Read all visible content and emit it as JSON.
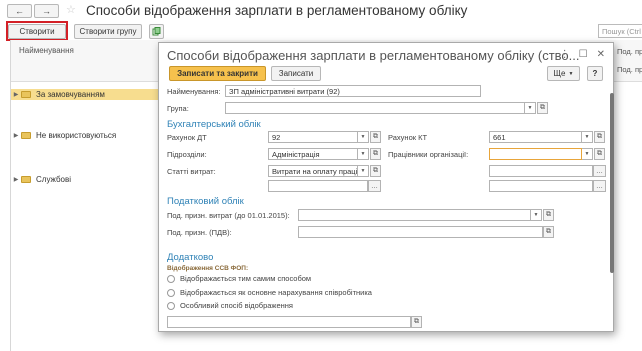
{
  "window": {
    "back": "←",
    "forward": "→",
    "title": "Способи відображення зарплати в регламентованому обліку"
  },
  "toolbar": {
    "create_label": "Створити",
    "create_group_label": "Створити групу",
    "search_placeholder": "Пошук (Ctrl"
  },
  "grid": {
    "col_name": "Найменування",
    "col_right_1": "Под. приз",
    "col_right_2": "Под. приз",
    "rows": [
      {
        "label": "За замовчуванням"
      },
      {
        "label": "Не використовуються"
      },
      {
        "label": "Службові"
      }
    ]
  },
  "dialog": {
    "title": "Способи відображення зарплати в регламентованому обліку (ство...",
    "save_close_label": "Записати та закрити",
    "save_label": "Записати",
    "more_label": "Ще",
    "help_label": "?",
    "name_label": "Найменування:",
    "name_value": "ЗП адміністративні витрати (92)",
    "group_label": "Група:",
    "group_value": "",
    "section_accounting": "Бухгалтерський облік",
    "dt_label": "Рахунок ДТ",
    "dt_value": "92",
    "kt_label": "Рахунок КТ",
    "kt_value": "661",
    "division_label": "Підрозділи:",
    "division_value": "Адміністрація",
    "employees_label": "Працівники організації:",
    "employees_value": "",
    "expense_label": "Статті витрат:",
    "expense_value": "Витрати на оплату праці",
    "section_tax": "Податковий облік",
    "tax_expense_label": "Под. призн. витрат (до 01.01.2015):",
    "tax_expense_value": "",
    "tax_vat_label": "Под. призн. (ПДВ):",
    "tax_vat_value": "",
    "section_extra": "Додатково",
    "ssv_title": "Відображення ССВ ФОП:",
    "radio_options": [
      "Відображається тим самим способом",
      "Відображається як основне нарахування співробітника",
      "Особливий спосіб відображення"
    ],
    "special_value": ""
  }
}
